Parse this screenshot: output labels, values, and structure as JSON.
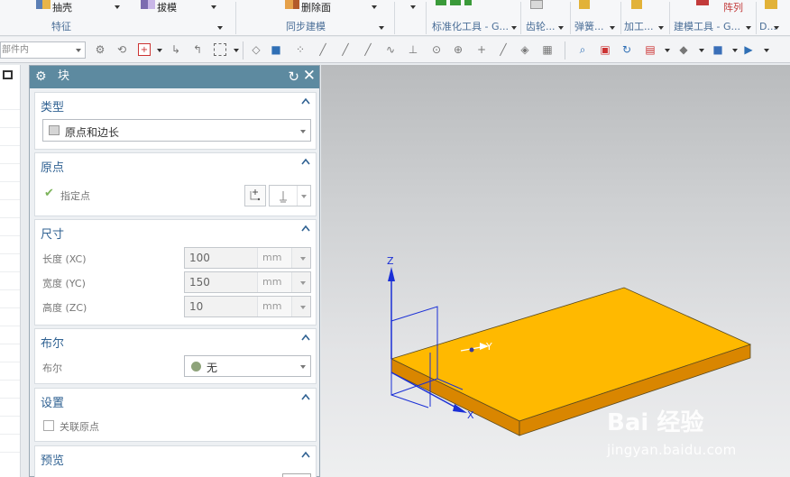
{
  "ribbon": {
    "top_items": [
      {
        "label": "抽壳"
      },
      {
        "label": "拔模"
      },
      {
        "label": "删除面"
      },
      {
        "label": "阵列"
      }
    ],
    "groups": [
      {
        "label": "特征"
      },
      {
        "label": "同步建模"
      },
      {
        "label": "标准化工具 - G..."
      },
      {
        "label": "齿轮..."
      },
      {
        "label": "弹簧..."
      },
      {
        "label": "加工..."
      },
      {
        "label": "建模工具 - G..."
      },
      {
        "label": "D..."
      }
    ]
  },
  "toolbar": {
    "filter_value": "部件内"
  },
  "dialog": {
    "title": "块",
    "sections": {
      "type": {
        "label": "类型",
        "value": "原点和边长"
      },
      "origin": {
        "label": "原点",
        "specify_point": "指定点"
      },
      "dimensions": {
        "label": "尺寸",
        "rows": [
          {
            "label": "长度 (XC)",
            "value": "100",
            "unit": "mm"
          },
          {
            "label": "宽度 (YC)",
            "value": "150",
            "unit": "mm"
          },
          {
            "label": "高度 (ZC)",
            "value": "10",
            "unit": "mm"
          }
        ]
      },
      "boolean": {
        "label": "布尔",
        "row_label": "布尔",
        "value": "无"
      },
      "settings": {
        "label": "设置",
        "checkbox_label": "关联原点",
        "checked": false
      },
      "preview": {
        "label": "预览"
      }
    }
  },
  "viewport": {
    "axis_labels": {
      "z": "Z",
      "y": "Y",
      "x": "X"
    },
    "block_color": "#ffb900",
    "block_side_color": "#d98600",
    "watermark_brand": "Bai 经验",
    "watermark_url": "jingyan.baidu.com"
  },
  "colors": {
    "dialog_header": "#5d8aa0",
    "section_label": "#2f6192",
    "ribbon_group_text": "#4a6e97"
  }
}
